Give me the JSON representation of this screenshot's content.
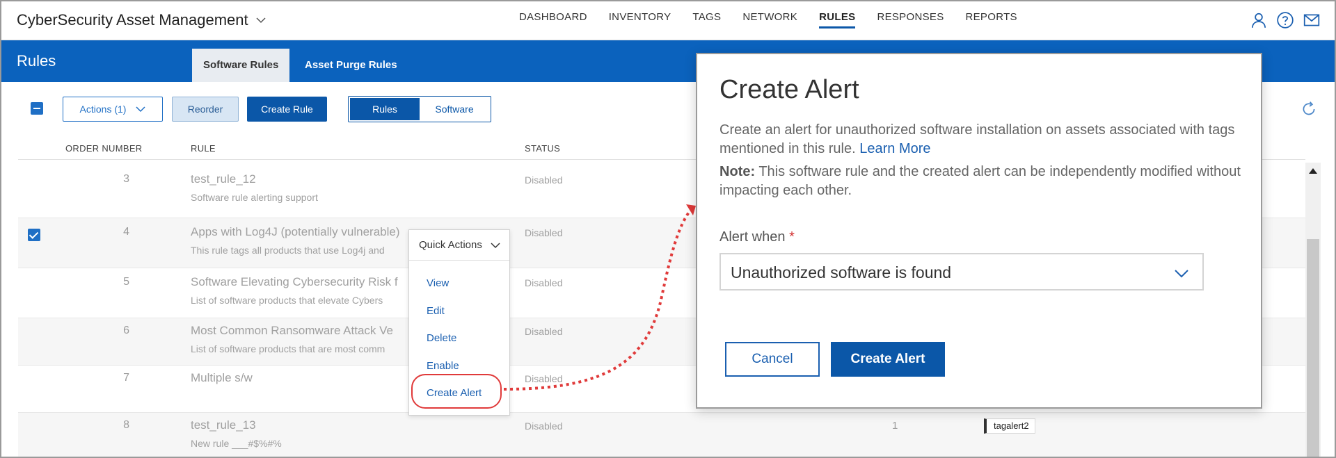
{
  "app": {
    "title": "CyberSecurity Asset Management",
    "nav": [
      "DASHBOARD",
      "INVENTORY",
      "TAGS",
      "NETWORK",
      "RULES",
      "RESPONSES",
      "REPORTS"
    ],
    "active_nav": "RULES",
    "icons": [
      "user-icon",
      "help-icon",
      "mail-icon"
    ]
  },
  "page": {
    "title": "Rules",
    "tabs": [
      "Software Rules",
      "Asset Purge Rules"
    ],
    "active_tab": "Software Rules"
  },
  "toolbar": {
    "actions_label": "Actions (1)",
    "reorder_label": "Reorder",
    "create_rule_label": "Create Rule",
    "toggle": [
      "Rules",
      "Software"
    ],
    "toggle_active": "Rules"
  },
  "table": {
    "headers": [
      "ORDER NUMBER",
      "RULE",
      "STATUS"
    ],
    "rows": [
      {
        "order": "3",
        "name": "test_rule_12",
        "desc": "Software rule alerting support",
        "status": "Disabled",
        "checked": false
      },
      {
        "order": "4",
        "name": "Apps with Log4J (potentially vulnerable)",
        "desc": "This rule tags all products that use Log4j and",
        "status": "Disabled",
        "checked": true
      },
      {
        "order": "5",
        "name": "Software Elevating Cybersecurity Risk f",
        "desc": "List of software products that elevate Cybers",
        "status": "Disabled",
        "checked": false
      },
      {
        "order": "6",
        "name": "Most Common Ransomware Attack Ve",
        "desc": "List of software products that are most comm",
        "status": "Disabled",
        "checked": false
      },
      {
        "order": "7",
        "name": "Multiple s/w",
        "desc": "",
        "status": "Disabled",
        "checked": false
      },
      {
        "order": "8",
        "name": "test_rule_13",
        "desc": "New rule ___#$%#%",
        "status": "Disabled",
        "checked": false,
        "count": "1",
        "tag": "tagalert2"
      }
    ]
  },
  "quick_actions": {
    "title": "Quick Actions",
    "items": [
      "View",
      "Edit",
      "Delete",
      "Enable",
      "Create Alert"
    ],
    "highlighted": "Create Alert"
  },
  "modal": {
    "title": "Create Alert",
    "description": "Create an alert for unauthorized software installation on assets associated with tags mentioned in this rule.",
    "learn_more": "Learn More",
    "note_label": "Note:",
    "note_text": "This software rule and the created alert can be independently modified without impacting each other.",
    "alert_when_label": "Alert when",
    "required_mark": "*",
    "alert_when_value": "Unauthorized software is found",
    "cancel_label": "Cancel",
    "create_label": "Create Alert"
  },
  "colors": {
    "brand_blue": "#0b62bd",
    "primary_button": "#0b57a8",
    "link": "#1a5fb0",
    "highlight_red": "#e03a3a"
  }
}
